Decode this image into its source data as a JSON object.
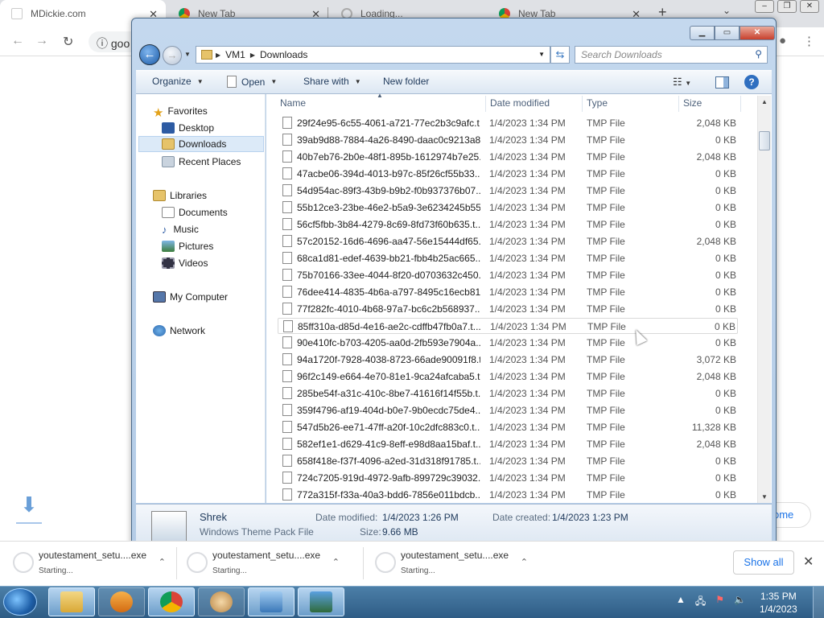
{
  "chrome": {
    "tabs": [
      {
        "title": "MDickie.com"
      },
      {
        "title": "New Tab"
      },
      {
        "title": "Loading..."
      },
      {
        "title": "New Tab"
      }
    ],
    "omnibox_text": "goo",
    "home_label": "ome"
  },
  "explorer": {
    "breadcrumb": [
      "VM1",
      "Downloads"
    ],
    "search_placeholder": "Search Downloads",
    "commands": {
      "organize": "Organize",
      "open": "Open",
      "share": "Share with",
      "newfolder": "New folder"
    },
    "nav": {
      "favorites": "Favorites",
      "desktop": "Desktop",
      "downloads": "Downloads",
      "recent": "Recent Places",
      "libraries": "Libraries",
      "documents": "Documents",
      "music": "Music",
      "pictures": "Pictures",
      "videos": "Videos",
      "computer": "My Computer",
      "network": "Network"
    },
    "columns": {
      "name": "Name",
      "date": "Date modified",
      "type": "Type",
      "size": "Size"
    },
    "files": [
      {
        "name": "29f24e95-6c55-4061-a721-77ec2b3c9afc.t...",
        "date": "1/4/2023 1:34 PM",
        "type": "TMP File",
        "size": "2,048 KB"
      },
      {
        "name": "39ab9d88-7884-4a26-8490-daac0c9213a8...",
        "date": "1/4/2023 1:34 PM",
        "type": "TMP File",
        "size": "0 KB"
      },
      {
        "name": "40b7eb76-2b0e-48f1-895b-1612974b7e25...",
        "date": "1/4/2023 1:34 PM",
        "type": "TMP File",
        "size": "2,048 KB"
      },
      {
        "name": "47acbe06-394d-4013-b97c-85f26cf55b33....",
        "date": "1/4/2023 1:34 PM",
        "type": "TMP File",
        "size": "0 KB"
      },
      {
        "name": "54d954ac-89f3-43b9-b9b2-f0b937376b07....",
        "date": "1/4/2023 1:34 PM",
        "type": "TMP File",
        "size": "0 KB"
      },
      {
        "name": "55b12ce3-23be-46e2-b5a9-3e6234245b55...",
        "date": "1/4/2023 1:34 PM",
        "type": "TMP File",
        "size": "0 KB"
      },
      {
        "name": "56cf5fbb-3b84-4279-8c69-8fd73f60b635.t...",
        "date": "1/4/2023 1:34 PM",
        "type": "TMP File",
        "size": "0 KB"
      },
      {
        "name": "57c20152-16d6-4696-aa47-56e15444df65....",
        "date": "1/4/2023 1:34 PM",
        "type": "TMP File",
        "size": "2,048 KB"
      },
      {
        "name": "68ca1d81-edef-4639-bb21-fbb4b25ac665....",
        "date": "1/4/2023 1:34 PM",
        "type": "TMP File",
        "size": "0 KB"
      },
      {
        "name": "75b70166-33ee-4044-8f20-d0703632c450....",
        "date": "1/4/2023 1:34 PM",
        "type": "TMP File",
        "size": "0 KB"
      },
      {
        "name": "76dee414-4835-4b6a-a797-8495c16ecb81....",
        "date": "1/4/2023 1:34 PM",
        "type": "TMP File",
        "size": "0 KB"
      },
      {
        "name": "77f282fc-4010-4b68-97a7-bc6c2b568937....",
        "date": "1/4/2023 1:34 PM",
        "type": "TMP File",
        "size": "0 KB"
      },
      {
        "name": "85ff310a-d85d-4e16-ae2c-cdffb47fb0a7.t...",
        "date": "1/4/2023 1:34 PM",
        "type": "TMP File",
        "size": "0 KB"
      },
      {
        "name": "90e410fc-b703-4205-aa0d-2fb593e7904a....",
        "date": "1/4/2023 1:34 PM",
        "type": "TMP File",
        "size": "0 KB"
      },
      {
        "name": "94a1720f-7928-4038-8723-66ade90091f8.t...",
        "date": "1/4/2023 1:34 PM",
        "type": "TMP File",
        "size": "3,072 KB"
      },
      {
        "name": "96f2c149-e664-4e70-81e1-9ca24afcaba5.t...",
        "date": "1/4/2023 1:34 PM",
        "type": "TMP File",
        "size": "2,048 KB"
      },
      {
        "name": "285be54f-a31c-410c-8be7-41616f14f55b.t...",
        "date": "1/4/2023 1:34 PM",
        "type": "TMP File",
        "size": "0 KB"
      },
      {
        "name": "359f4796-af19-404d-b0e7-9b0ecdc75de4....",
        "date": "1/4/2023 1:34 PM",
        "type": "TMP File",
        "size": "0 KB"
      },
      {
        "name": "547d5b26-ee71-47ff-a20f-10c2dfc883c0.t...",
        "date": "1/4/2023 1:34 PM",
        "type": "TMP File",
        "size": "11,328 KB"
      },
      {
        "name": "582ef1e1-d629-41c9-8eff-e98d8aa15baf.t...",
        "date": "1/4/2023 1:34 PM",
        "type": "TMP File",
        "size": "2,048 KB"
      },
      {
        "name": "658f418e-f37f-4096-a2ed-31d318f91785.t...",
        "date": "1/4/2023 1:34 PM",
        "type": "TMP File",
        "size": "0 KB"
      },
      {
        "name": "724c7205-919d-4972-9afb-899729c39032....",
        "date": "1/4/2023 1:34 PM",
        "type": "TMP File",
        "size": "0 KB"
      },
      {
        "name": "772a315f-f33a-40a3-bdd6-7856e011bdcb....",
        "date": "1/4/2023 1:34 PM",
        "type": "TMP File",
        "size": "0 KB"
      }
    ],
    "details": {
      "name": "Shrek",
      "type": "Windows Theme Pack File",
      "modified_label": "Date modified:",
      "modified_value": "1/4/2023 1:26 PM",
      "created_label": "Date created:",
      "created_value": "1/4/2023 1:23 PM",
      "size_label": "Size:",
      "size_value": "9.66 MB"
    }
  },
  "downloads": [
    {
      "file": "youtestament_setu....exe",
      "status": "Starting..."
    },
    {
      "file": "youtestament_setu....exe",
      "status": "Starting..."
    },
    {
      "file": "youtestament_setu....exe",
      "status": "Starting..."
    }
  ],
  "show_all": "Show all",
  "clock": {
    "time": "1:35 PM",
    "date": "1/4/2023"
  }
}
